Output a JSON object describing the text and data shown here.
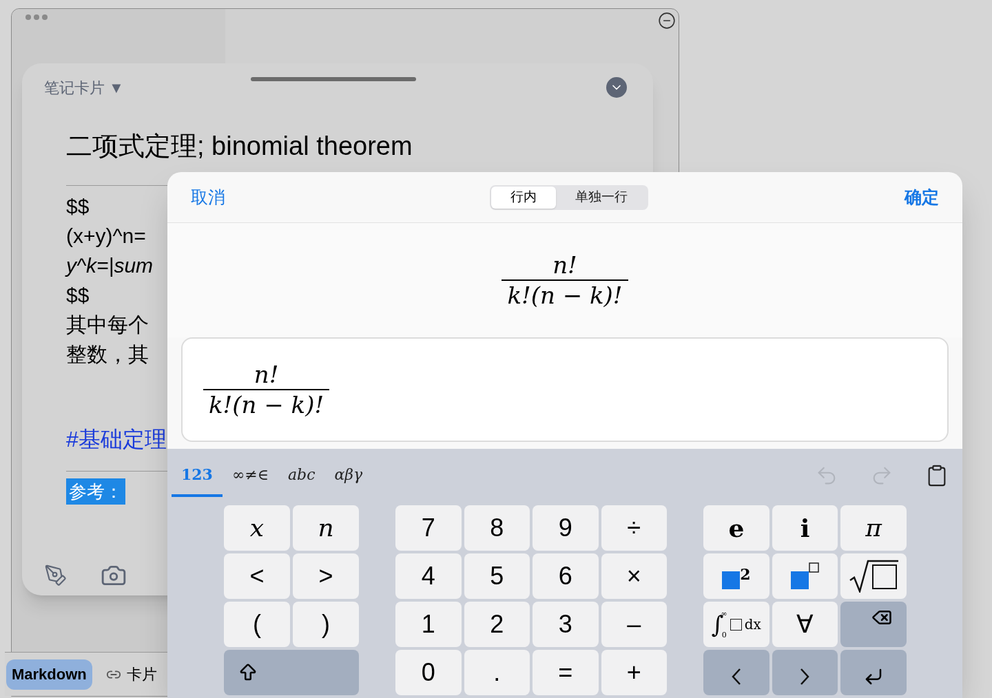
{
  "background_window": {
    "bottom_bar": [
      {
        "kind": "text",
        "label": "Markdown",
        "selected": true
      },
      {
        "kind": "link",
        "label": "卡片",
        "selected": false
      }
    ]
  },
  "card": {
    "type_menu": "笔记卡片 ▼",
    "title": "二项式定理; binomial theorem",
    "body": [
      {
        "kind": "plain",
        "text": "$$"
      },
      {
        "kind": "plain",
        "text": "(x+y)^n="
      },
      {
        "kind": "italic",
        "text": "y^k=|sum"
      },
      {
        "kind": "plain",
        "text": "$$"
      },
      {
        "kind": "plain",
        "text": "其中每个"
      },
      {
        "kind": "plain",
        "text": "整数，其"
      }
    ],
    "tag": "#基础定理",
    "reference": "参考："
  },
  "dialog": {
    "cancel": "取消",
    "confirm": "确定",
    "modes": [
      {
        "label": "行内",
        "selected": true
      },
      {
        "label": "单独一行",
        "selected": false
      }
    ],
    "preview": {
      "numerator": "n!",
      "denominator": "k!(n − k)!"
    },
    "field": {
      "numerator": "n!",
      "denominator": "k!(n − k)!"
    }
  },
  "keyboard": {
    "tabs": [
      {
        "label": "123",
        "selected": true
      },
      {
        "label": "∞≠∈",
        "selected": false
      },
      {
        "label": "abc",
        "selected": false
      },
      {
        "label": "αβγ",
        "selected": false
      }
    ],
    "actions": [
      {
        "kind": "undo",
        "disabled": true
      },
      {
        "kind": "redo",
        "disabled": true
      },
      {
        "kind": "paste",
        "disabled": false
      }
    ],
    "groups": [
      {
        "keys": [
          {
            "kind": "var",
            "label": "x"
          },
          {
            "kind": "var",
            "label": "n"
          },
          {
            "kind": "char",
            "label": "<"
          },
          {
            "kind": "char",
            "label": ">"
          },
          {
            "kind": "char",
            "label": "("
          },
          {
            "kind": "char",
            "label": ")"
          },
          {
            "kind": "shift"
          }
        ]
      },
      {
        "keys": [
          {
            "kind": "char",
            "label": "7"
          },
          {
            "kind": "char",
            "label": "8"
          },
          {
            "kind": "char",
            "label": "9"
          },
          {
            "kind": "char",
            "label": "÷"
          },
          {
            "kind": "char",
            "label": "4"
          },
          {
            "kind": "char",
            "label": "5"
          },
          {
            "kind": "char",
            "label": "6"
          },
          {
            "kind": "char",
            "label": "×"
          },
          {
            "kind": "char",
            "label": "1"
          },
          {
            "kind": "char",
            "label": "2"
          },
          {
            "kind": "char",
            "label": "3"
          },
          {
            "kind": "char",
            "label": "–"
          },
          {
            "kind": "char",
            "label": "0"
          },
          {
            "kind": "char",
            "label": "."
          },
          {
            "kind": "char",
            "label": "="
          },
          {
            "kind": "char",
            "label": "+"
          }
        ]
      },
      {
        "keys": [
          {
            "kind": "const",
            "label": "e"
          },
          {
            "kind": "const",
            "label": "i"
          },
          {
            "kind": "var",
            "label": "π"
          },
          {
            "kind": "square",
            "label": "2"
          },
          {
            "kind": "power"
          },
          {
            "kind": "sqrt"
          },
          {
            "kind": "integral",
            "sign": "∫",
            "upper": "∞",
            "lower": "0",
            "label": "dx"
          },
          {
            "kind": "char",
            "label": "∀"
          },
          {
            "kind": "backspace"
          },
          {
            "kind": "left"
          },
          {
            "kind": "right"
          },
          {
            "kind": "enter"
          }
        ]
      }
    ]
  }
}
